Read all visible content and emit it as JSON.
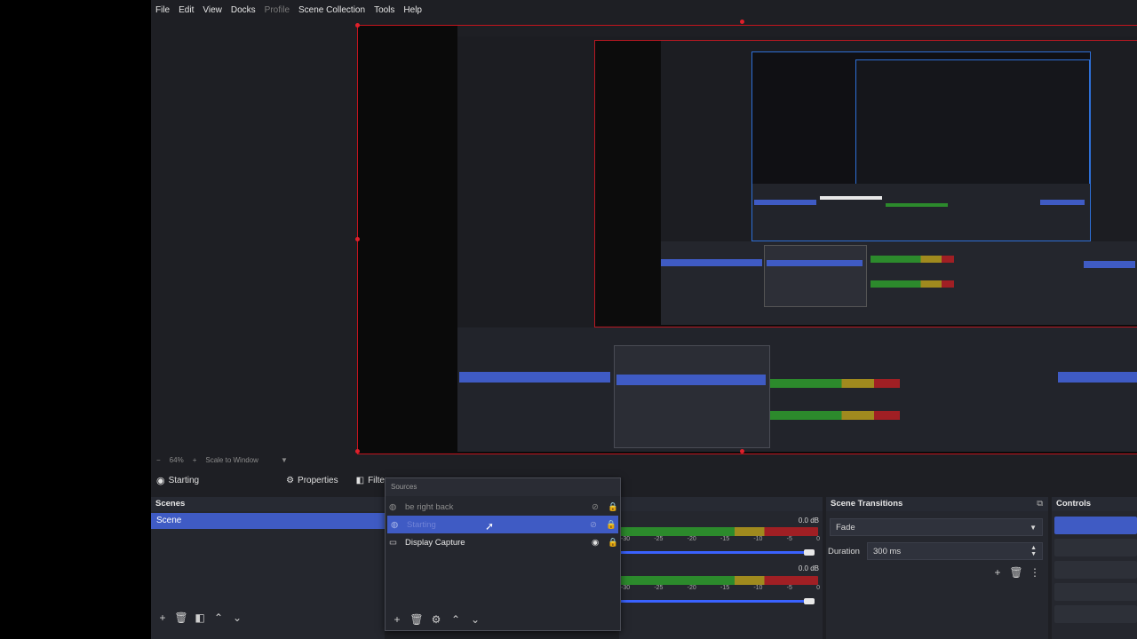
{
  "menu": [
    "File",
    "Edit",
    "View",
    "Docks",
    "Profile",
    "Scene Collection",
    "Tools",
    "Help"
  ],
  "menu_dim": "Profile",
  "zoom": {
    "value": "64%",
    "add": "+",
    "minus": "−",
    "mode": "Scale to Window"
  },
  "context": {
    "source_name": "Starting",
    "properties": "Properties",
    "filters": "Filters"
  },
  "scenes": {
    "title": "Scenes",
    "items": [
      "Scene"
    ]
  },
  "sources": {
    "title": "Sources",
    "items": [
      {
        "name": "be right back",
        "visible": false
      },
      {
        "name": "Starting",
        "visible": false,
        "selected": true
      },
      {
        "name": "Display Capture",
        "visible": true
      }
    ]
  },
  "mixer": {
    "tracks": [
      {
        "db": "0.0 dB",
        "ticks": [
          "-30",
          "-25",
          "-20",
          "-15",
          "-10",
          "-5",
          "0"
        ]
      },
      {
        "db": "0.0 dB",
        "ticks": [
          "-30",
          "-25",
          "-20",
          "-15",
          "-10",
          "-5",
          "0"
        ]
      }
    ]
  },
  "transitions": {
    "title": "Scene Transitions",
    "type": "Fade",
    "duration_label": "Duration",
    "duration_value": "300 ms"
  },
  "controls": {
    "title": "Controls"
  },
  "colors": {
    "accent": "#3f5bc4",
    "selection_outline": "#c4141e",
    "meter_green": "#2c8a2c",
    "meter_yellow": "#a08a1e",
    "meter_red": "#a01f24"
  }
}
